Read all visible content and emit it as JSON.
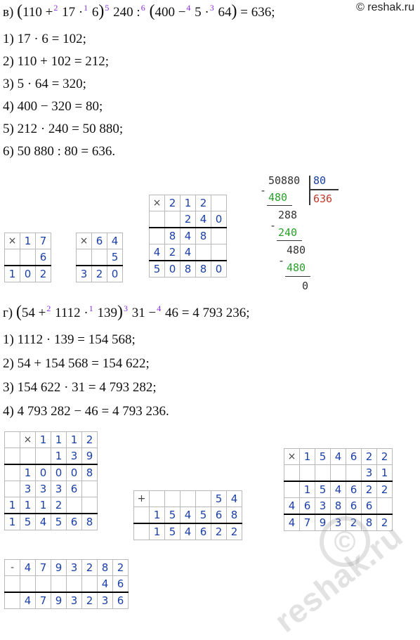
{
  "watermark": "© reshak.ru",
  "watermark_big": "reshak.ru",
  "watermark_c": "©",
  "part_v": {
    "label": "в)",
    "expr": {
      "a": "110 +",
      "s2": "2",
      "b": "17 ·",
      "s1": "1",
      "c": "6",
      "s5": "5",
      "d": "240 :",
      "s6": "6",
      "e": "400 −",
      "s4": "4",
      "f": "5 ·",
      "s3": "3",
      "g": "64",
      "result": "= 636;"
    },
    "steps": [
      "1) 17 · 6 = 102;",
      "2) 110 + 102 = 212;",
      "3) 5 · 64 = 320;",
      "4) 400 − 320 = 80;",
      "5) 212 · 240 = 50 880;",
      "6) 50 880 : 80 = 636."
    ]
  },
  "part_g": {
    "label": "г)",
    "expr": {
      "a": "54 +",
      "s2": "2",
      "b": "1112 ·",
      "s1": "1",
      "c": "139",
      "s3": "3",
      "d": "31 −",
      "s4": "4",
      "e": "46 = 4 793 236;"
    },
    "steps": [
      "1) 1112 · 139 = 154 568;",
      "2) 54 + 154 568 = 154 622;",
      "3) 154 622 · 31 = 4 793 282;",
      "4) 4 793 282 − 46 = 4 793 236."
    ]
  },
  "grids": {
    "m17": [
      [
        "×",
        "1",
        "7"
      ],
      [
        "",
        "",
        "6"
      ],
      [
        "1",
        "0",
        "2"
      ]
    ],
    "m64": [
      [
        "×",
        "6",
        "4"
      ],
      [
        "",
        "",
        "5"
      ],
      [
        "3",
        "2",
        "0"
      ]
    ],
    "m212": [
      [
        "×",
        "2",
        "1",
        "2",
        ""
      ],
      [
        "",
        "",
        "2",
        "4",
        "0"
      ],
      [
        "",
        "8",
        "4",
        "8",
        ""
      ],
      [
        "4",
        "2",
        "4",
        "",
        ""
      ],
      [
        "5",
        "0",
        "8",
        "8",
        "0"
      ]
    ],
    "m1112": [
      [
        "",
        "×",
        "1",
        "1",
        "1",
        "2"
      ],
      [
        "",
        "",
        "",
        "1",
        "3",
        "9"
      ],
      [
        "",
        "1",
        "0",
        "0",
        "0",
        "8"
      ],
      [
        "",
        "3",
        "3",
        "3",
        "6",
        ""
      ],
      [
        "1",
        "1",
        "1",
        "2",
        "",
        ""
      ],
      [
        "1",
        "5",
        "4",
        "5",
        "6",
        "8"
      ]
    ],
    "a54": [
      [
        "+",
        "",
        "",
        "",
        "",
        "5",
        "4"
      ],
      [
        "",
        "1",
        "5",
        "4",
        "5",
        "6",
        "8"
      ],
      [
        "",
        "1",
        "5",
        "4",
        "6",
        "2",
        "2"
      ]
    ],
    "m154622": [
      [
        "×",
        "1",
        "5",
        "4",
        "6",
        "2",
        "2"
      ],
      [
        "",
        "",
        "",
        "",
        "",
        "3",
        "1"
      ],
      [
        "",
        "1",
        "5",
        "4",
        "6",
        "2",
        "2"
      ],
      [
        "4",
        "6",
        "3",
        "8",
        "6",
        "6",
        ""
      ],
      [
        "4",
        "7",
        "9",
        "3",
        "2",
        "8",
        "2"
      ]
    ],
    "s4793282": [
      [
        "-",
        "4",
        "7",
        "9",
        "3",
        "2",
        "8",
        "2"
      ],
      [
        "",
        "",
        "",
        "",
        "",
        "",
        "4",
        "6"
      ],
      [
        "",
        "4",
        "7",
        "9",
        "3",
        "2",
        "3",
        "6"
      ]
    ]
  },
  "division": {
    "dividend": "50880",
    "divisor": "80",
    "quotient": "636",
    "sub1": "480",
    "rem1": "288",
    "sub2": "240",
    "rem2": "480",
    "sub3": "480",
    "final": "0",
    "minus": "-"
  }
}
